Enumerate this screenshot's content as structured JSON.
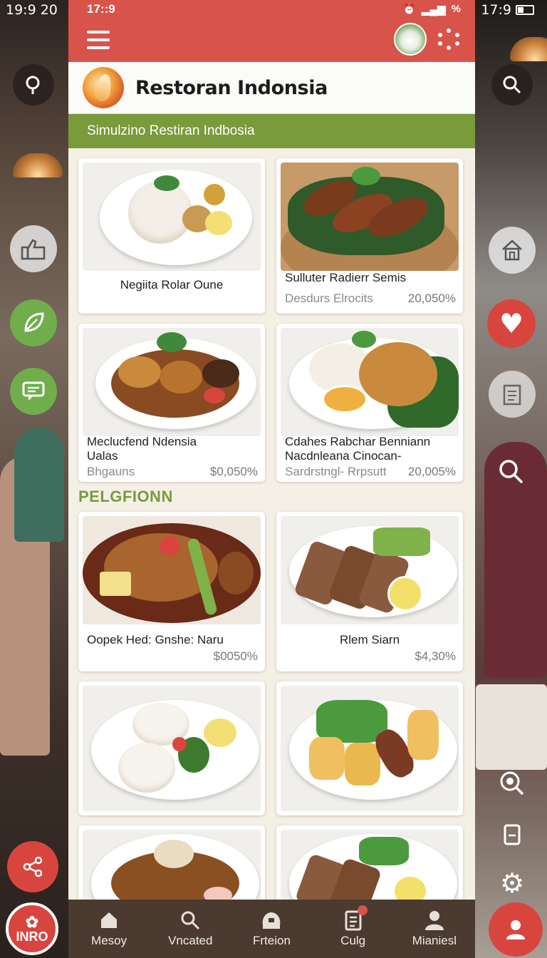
{
  "left_status": {
    "time": "19:9 20"
  },
  "right_status": {
    "time": "17:9"
  },
  "status": {
    "time": "17::9",
    "icons": [
      "alarm-icon",
      "signal-icon",
      "battery-icon"
    ],
    "battery_text": "%"
  },
  "app": {
    "title": "Restoran Indonsia",
    "subtitle": "Simulzino Restiran Indbosia"
  },
  "section": {
    "label": "PELGFIONN"
  },
  "cards": [
    {
      "title": "Negiita Rolar Oune",
      "meta": "",
      "price": ""
    },
    {
      "title": "Sulluter Radierr Semis",
      "meta": "Desdurs Elrocits",
      "price": "20,050%"
    },
    {
      "title": "Meclucfend Ndensia\nUalas",
      "meta": "Bhgauns",
      "price": "$0,050%"
    },
    {
      "title": "Cdahes Rabchar Benniann\nNacdnleana Cinocan-",
      "meta": "Sardrstngl- Rrpsutt",
      "price": "20,005%"
    },
    {
      "title": "Oopek Hed: Gnshe: Naru",
      "meta": "",
      "price": "$0050%"
    },
    {
      "title": "Rlem Siarn",
      "meta": "",
      "price": "$4,30%"
    }
  ],
  "bottom_nav": [
    {
      "label": "Mesoy",
      "icon": "home-icon"
    },
    {
      "label": "Vncated",
      "icon": "search-icon"
    },
    {
      "label": "Frteion",
      "icon": "chef-hat-icon"
    },
    {
      "label": "Culg",
      "icon": "document-icon"
    },
    {
      "label": "Mianiesl",
      "icon": "profile-icon"
    }
  ],
  "info_button": {
    "label": "INRO"
  },
  "colors": {
    "primary": "#d8534a",
    "green": "#7a9a3b",
    "nav": "#4a3a30",
    "background": "#f4f0e6"
  }
}
